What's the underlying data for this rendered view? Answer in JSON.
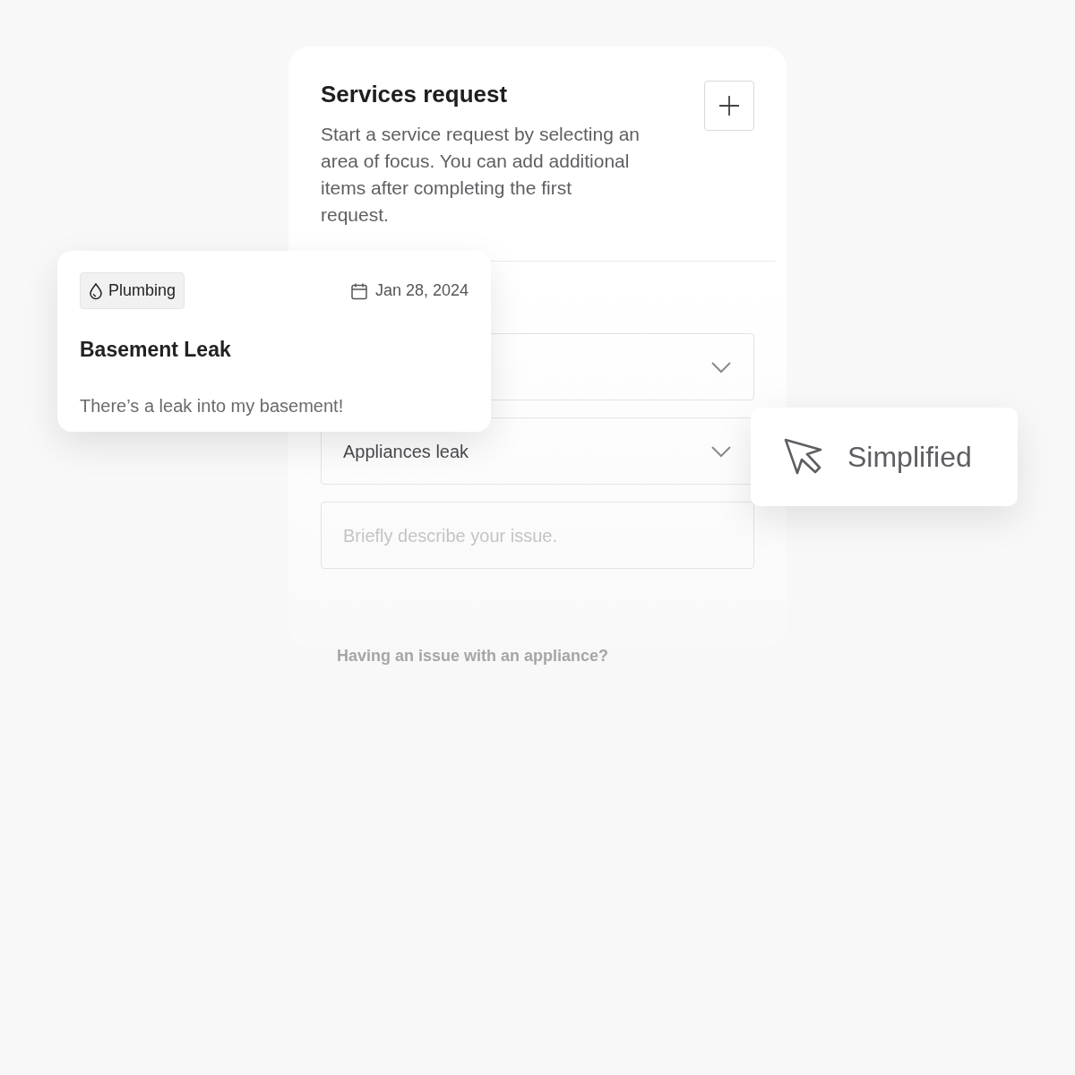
{
  "form": {
    "title": "Services request",
    "description": "Start a service request by selecting an area of focus. You can add additional items after completing the first request.",
    "fields": [
      {
        "kind": "select"
      },
      {
        "kind": "select",
        "value": "Appliances leak"
      },
      {
        "kind": "textarea",
        "placeholder": "Briefly describe your issue."
      }
    ],
    "hint": "Having an issue with an appliance?"
  },
  "request_card": {
    "category": "Plumbing",
    "date": "Jan 28, 2024",
    "title": "Basement Leak",
    "message": "There’s a leak into my basement!"
  },
  "callout": {
    "label": "Simplified"
  }
}
